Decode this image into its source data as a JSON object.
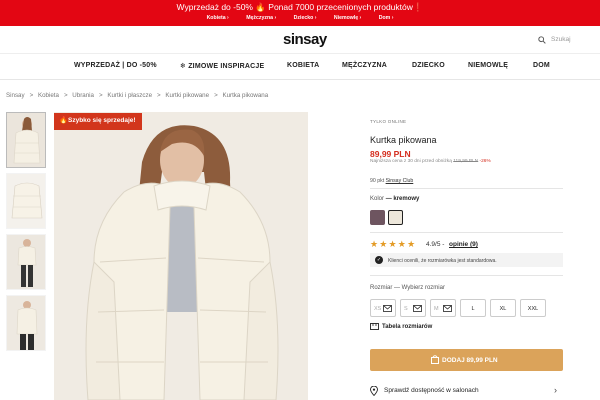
{
  "promo": {
    "text": "Wyprzedaż do -50% 🔥 Ponad 7000 przecenionych produktów❗",
    "links": [
      "Kobieta ›",
      "Mężczyzna ›",
      "Dziecko ›",
      "Niemowlę ›",
      "Dom ›"
    ]
  },
  "header": {
    "logo": "sinsay",
    "search_placeholder": "Szukaj"
  },
  "nav": [
    "WYPRZEDAŻ | DO -50%",
    "❄ ZIMOWE INSPIRACJE",
    "KOBIETA",
    "MĘŻCZYZNA",
    "DZIECKO",
    "NIEMOWLĘ",
    "DOM"
  ],
  "breadcrumb": [
    "Sinsay",
    "Kobieta",
    "Ubrania",
    "Kurtki i płaszcze",
    "Kurtki pikowane",
    "Kurtka pikowana"
  ],
  "breadcrumb_sep": ">",
  "badge": {
    "icon": "flame-icon",
    "text": "Szybko się sprzedaje!"
  },
  "product": {
    "tag": "TYLKO ONLINE",
    "title": "Kurtka pikowana",
    "price": "89,99 PLN",
    "lowest_label": "Najniższa cena z 30 dni przed obniżką",
    "old_price": "119,99 PLN",
    "discount": "-26%",
    "club_text": "90 pkt",
    "club_link": "Sinsay Club",
    "color_label": "Kolor",
    "color_value": "— kremowy",
    "colors": [
      "#6e5560",
      "#ede7db"
    ],
    "rating_value": 4.9,
    "rating_text": "4.9/5 -",
    "opinions": "opinie (9)",
    "fit_note": "Klienci ocenili, że rozmiarówka jest standardowa.",
    "size_label": "Rozmiar — Wybierz rozmiar",
    "sizes": [
      {
        "label": "XS",
        "available": false
      },
      {
        "label": "S",
        "available": false
      },
      {
        "label": "M",
        "available": false
      },
      {
        "label": "L",
        "available": true
      },
      {
        "label": "XL",
        "available": true
      },
      {
        "label": "XXL",
        "available": true
      }
    ],
    "size_table": "Tabela rozmiarów",
    "add_button": "DODAJ 89,99 PLN",
    "availability": "Sprawdź dostępność w salonach"
  },
  "colors": {
    "accent": "#e30613",
    "price": "#d42d1e",
    "add_button": "#dba35a",
    "stars": "#e39b26"
  }
}
